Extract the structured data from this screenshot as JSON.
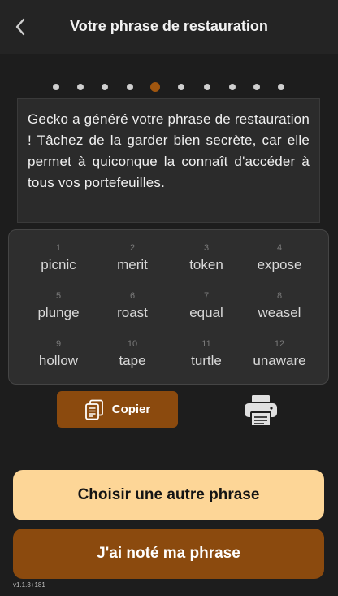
{
  "header": {
    "title": "Votre phrase de restauration",
    "back_icon": "chevron-left-icon"
  },
  "progress": {
    "total_steps": 10,
    "current_step": 5,
    "active_color": "#a0560f",
    "inactive_color": "#cfcfcf"
  },
  "message": "Gecko a généré votre phrase de restauration ! Tâchez de la garder bien secrète, car elle permet à quiconque la connaît d'accéder à tous vos portefeuilles.",
  "words": [
    {
      "num": "1",
      "word": "picnic"
    },
    {
      "num": "2",
      "word": "merit"
    },
    {
      "num": "3",
      "word": "token"
    },
    {
      "num": "4",
      "word": "expose"
    },
    {
      "num": "5",
      "word": "plunge"
    },
    {
      "num": "6",
      "word": "roast"
    },
    {
      "num": "7",
      "word": "equal"
    },
    {
      "num": "8",
      "word": "weasel"
    },
    {
      "num": "9",
      "word": "hollow"
    },
    {
      "num": "10",
      "word": "tape"
    },
    {
      "num": "11",
      "word": "turtle"
    },
    {
      "num": "12",
      "word": "unaware"
    }
  ],
  "actions": {
    "copy_label": "Copier",
    "copy_icon": "copy-document-icon",
    "print_icon": "printer-icon",
    "choose_other_label": "Choisir une autre phrase",
    "noted_label": "J'ai noté ma phrase"
  },
  "version": "v1.1.3+181",
  "colors": {
    "brand_brown": "#8b4a0e",
    "brand_light": "#fdd697",
    "background": "#1d1d1d"
  }
}
